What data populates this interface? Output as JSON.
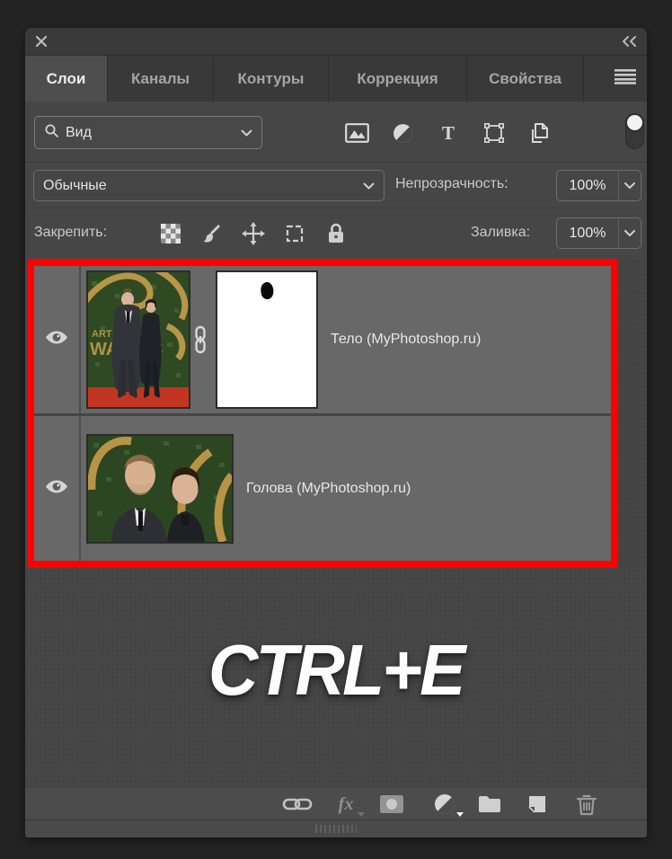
{
  "colors": {
    "selection_highlight": "#ff0000",
    "panel_bg": "#464646",
    "selected_row_bg": "#686868"
  },
  "tabs": [
    {
      "label": "Слои",
      "active": true
    },
    {
      "label": "Каналы",
      "active": false
    },
    {
      "label": "Контуры",
      "active": false
    },
    {
      "label": "Коррекция",
      "active": false
    },
    {
      "label": "Свойства",
      "active": false
    }
  ],
  "filter_row": {
    "kind_value": "Вид",
    "text_filter_glyph": "T"
  },
  "blend_row": {
    "mode_value": "Обычные",
    "opacity_label": "Непрозрачность:",
    "opacity_value": "100%"
  },
  "lock_row": {
    "label": "Закрепить:",
    "fill_label": "Заливка:",
    "fill_value": "100%"
  },
  "layers": [
    {
      "name": "Тело (MyPhotoshop.ru)",
      "visible": true,
      "linked_mask": true
    },
    {
      "name": "Голова (MyPhotoshop.ru)",
      "visible": true
    }
  ],
  "merge_hint": {
    "text": "CTRL+E"
  },
  "toolbar": {
    "fx_label": "fx"
  }
}
